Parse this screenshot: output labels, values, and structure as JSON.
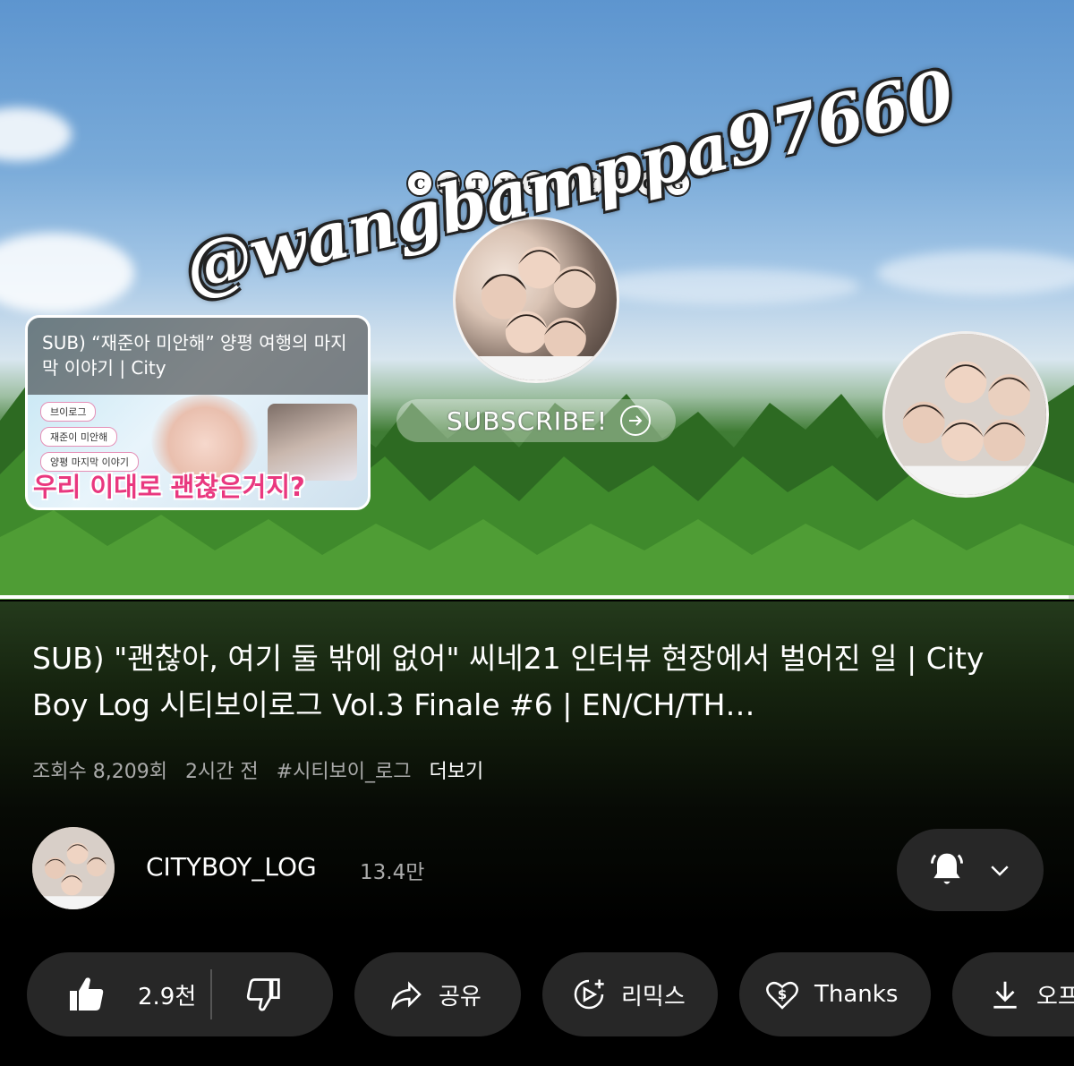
{
  "banner": {
    "logo_letters": [
      "C",
      "I",
      "T",
      "Y",
      "B",
      "O",
      "Y",
      "L",
      "O",
      "G"
    ],
    "subscribe_label": "SUBSCRIBE!",
    "watermark": "@wangbamppa97660",
    "progress_fraction": 0.995
  },
  "thumbnail": {
    "title": "SUB) “재준아 미안해” 양평 여행의 마지막 이야기 | City",
    "bubbles": [
      "브이로그",
      "재준이 미안해",
      "양평 마지막 이야기"
    ],
    "caption": "우리 이대로 괜찮은거지?"
  },
  "video": {
    "title": "SUB) \"괜찮아, 여기 둘 밖에 없어\" 씨네21 인터뷰 현장에서 벌어진 일 | City Boy Log 시티보이로그 Vol.3 Finale #6 | EN/CH/TH…",
    "views": "조회수 8,209회",
    "age": "2시간 전",
    "hashtag": "#시티보이_로그",
    "more": "더보기"
  },
  "channel": {
    "name": "CITYBOY_LOG",
    "subscribers": "13.4만"
  },
  "actions": {
    "likes": "2.9천",
    "share": "공유",
    "remix": "리믹스",
    "thanks": "Thanks",
    "download": "오프"
  },
  "icons": [
    "thumbs-up-icon",
    "thumbs-down-icon",
    "share-icon",
    "remix-icon",
    "thanks-heart-icon",
    "download-icon",
    "bell-icon",
    "chevron-down-icon",
    "arrow-right-icon"
  ]
}
